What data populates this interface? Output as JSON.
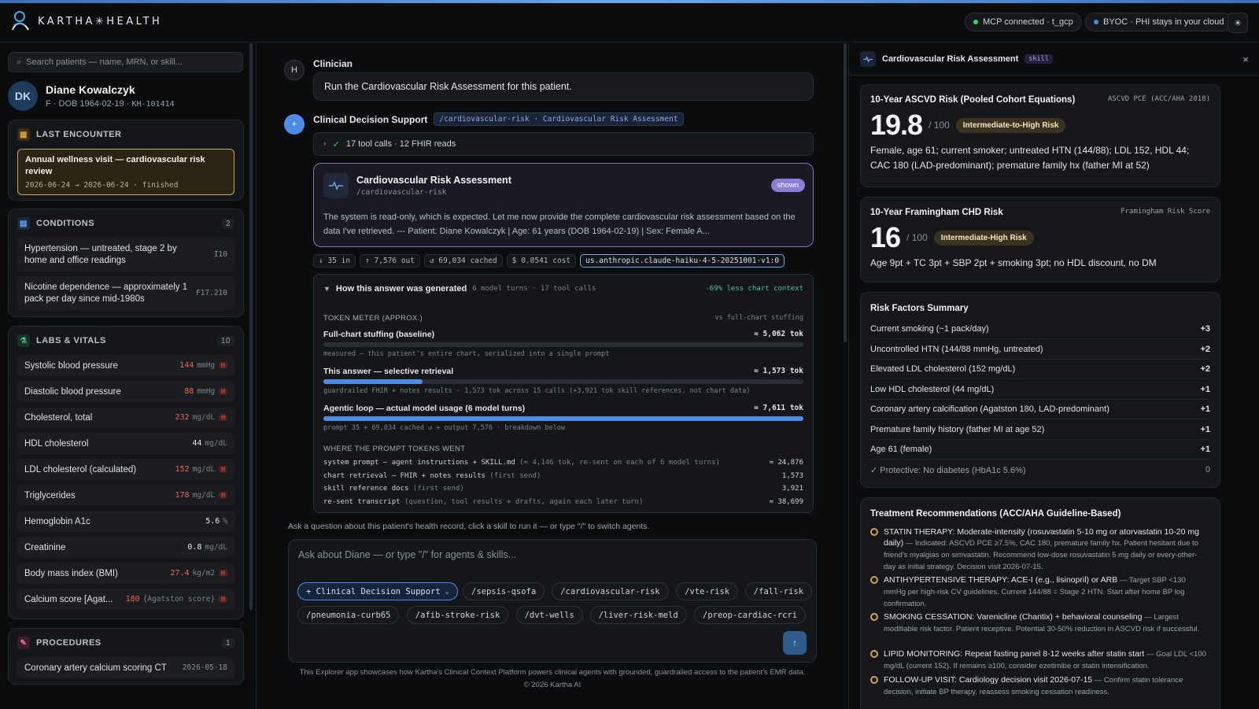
{
  "app": {
    "brand": "KARTHA✳HEALTH"
  },
  "header": {
    "mcp_status": "MCP connected · t_gcp",
    "byoc_status": "BYOC · PHI stays in your cloud",
    "mcp_color": "#3ecf6a",
    "byoc_color": "#4d8be8"
  },
  "sidebar": {
    "search_placeholder": "Search patients — name, MRN, or skill...",
    "patient": {
      "initials": "DK",
      "name": "Diane Kowalczyk",
      "meta": "F · DOB 1964-02-19 ·",
      "mrn": "KH-101414"
    },
    "last_encounter": {
      "heading": "LAST ENCOUNTER",
      "title": "Annual wellness visit — cardiovascular risk review",
      "dates": "2026-06-24 → 2026-06-24 · finished"
    },
    "conditions": {
      "heading": "CONDITIONS",
      "count": "2",
      "items": [
        {
          "label": "Hypertension — untreated, stage 2 by home and office readings",
          "code": "I10"
        },
        {
          "label": "Nicotine dependence — approximately 1 pack per day since mid-1980s",
          "code": "F17.210"
        }
      ]
    },
    "labs": {
      "heading": "LABS & VITALS",
      "count": "10",
      "items": [
        {
          "label": "Systolic blood pressure",
          "value": "144",
          "unit": "mmHg",
          "flag": "H"
        },
        {
          "label": "Diastolic blood pressure",
          "value": "88",
          "unit": "mmHg",
          "flag": "H"
        },
        {
          "label": "Cholesterol, total",
          "value": "232",
          "unit": "mg/dL",
          "flag": "H"
        },
        {
          "label": "HDL cholesterol",
          "value": "44",
          "unit": "mg/dL",
          "flag": ""
        },
        {
          "label": "LDL cholesterol (calculated)",
          "value": "152",
          "unit": "mg/dL",
          "flag": "H"
        },
        {
          "label": "Triglycerides",
          "value": "178",
          "unit": "mg/dL",
          "flag": "H"
        },
        {
          "label": "Hemoglobin A1c",
          "value": "5.6",
          "unit": "%",
          "flag": ""
        },
        {
          "label": "Creatinine",
          "value": "0.8",
          "unit": "mg/dL",
          "flag": ""
        },
        {
          "label": "Body mass index (BMI)",
          "value": "27.4",
          "unit": "kg/m2",
          "flag": "H"
        },
        {
          "label": "Calcium score [Agat...",
          "value": "180",
          "unit": "{Agatston score}",
          "flag": "H"
        }
      ]
    },
    "procedures": {
      "heading": "PROCEDURES",
      "count": "1",
      "items": [
        {
          "label": "Coronary artery calcium scoring CT",
          "date": "2026-05-18"
        }
      ]
    }
  },
  "chat": {
    "clinician": {
      "avatar": "H",
      "name": "Clinician",
      "message": "Run the Cardiovascular Risk Assessment for this patient."
    },
    "agent": {
      "avatar": "+",
      "name": "Clinical Decision Support",
      "route_tag": "/cardiovascular-risk · Cardiovascular Risk Assessment"
    },
    "tool_summary": "17 tool calls · 12 FHIR reads",
    "skill_card": {
      "title": "Cardiovascular Risk Assessment",
      "path": "/cardiovascular-risk",
      "badge": "shown",
      "preview": "The system is read-only, which is expected. Let me now provide the complete cardiovascular risk assessment based on the data I've retrieved. --- Patient: Diane Kowalczyk | Age: 61 years (DOB 1964-02-19) | Sex: Female  A..."
    },
    "stats": {
      "in": "↓ 35 in",
      "out": "↑ 7,576 out",
      "cached": "↺ 69,034 cached",
      "cost": "$ 0.0541 cost",
      "model": "us.anthropic.claude-haiku-4-5-20251001-v1:0"
    },
    "generation": {
      "heading": "How this answer was generated",
      "meta": "6 model turns · 17 tool calls",
      "savings": "-69% less chart context",
      "token_meter": "TOKEN METER (APPROX.)",
      "vs_label": "vs full-chart stuffing",
      "rows": [
        {
          "label": "Full-chart stuffing (baseline)",
          "value": "≈ 5,062 tok",
          "sub": "measured — this patient's entire chart, serialized into a single prompt",
          "fraction": 0
        },
        {
          "label": "This answer — selective retrieval",
          "value": "≈ 1,573 tok",
          "sub": "guardrailed FHIR + notes results · 1,573 tok across 15 calls (+3,921 tok skill references, not chart data)",
          "fraction": 0.207
        },
        {
          "label": "Agentic loop — actual model usage (6 model turns)",
          "value": "≈ 7,611 tok",
          "sub": "prompt 35 + 69,034 cached ↺ + output 7,576 · breakdown below",
          "fraction": 1
        }
      ],
      "prompt_heading": "WHERE THE PROMPT TOKENS WENT",
      "prompt_rows": [
        {
          "label": "system prompt — agent instructions + SKILL.md",
          "note": "(≈ 4,146 tok, re-sent on each of 6 model turns)",
          "value": "≈ 24,876"
        },
        {
          "label": "chart retrieval — FHIR + notes results",
          "note": "(first send)",
          "value": "1,573"
        },
        {
          "label": "skill reference docs",
          "note": "(first send)",
          "value": "3,921"
        },
        {
          "label": "re-sent transcript",
          "note": "(question, tool results + drafts, again each later turn)",
          "value": "≈ 38,699"
        }
      ]
    },
    "hint": "Ask a question about this patient's health record, click a skill to run it — or type \"/\" to switch agents.",
    "composer": {
      "placeholder": "Ask about Diane — or type \"/\" for agents & skills...",
      "agent_select": "+ Clinical Decision Support",
      "skills_row1": [
        "/sepsis-qsofa",
        "/cardiovascular-risk",
        "/vte-risk",
        "/fall-risk"
      ],
      "skills_row2": [
        "/pneumonia-curb65",
        "/afib-stroke-risk",
        "/dvt-wells",
        "/liver-risk-meld",
        "/preop-cardiac-rcri"
      ]
    },
    "footer": "This Explorer app showcases how Kartha's Clinical Context Platform powers clinical agents with grounded, guardrailed access to the patient's EMR data.",
    "copyright": "© 2026 Kartha AI"
  },
  "panel": {
    "title": "Cardiovascular Risk Assessment",
    "tag": "skill",
    "ascvd": {
      "title": "10-Year ASCVD Risk (Pooled Cohort Equations)",
      "method": "ASCVD PCE (ACC/AHA 2018)",
      "score": "19.8",
      "of": "/ 100",
      "badge": "Intermediate-to-High Risk",
      "desc": "Female, age 61; current smoker; untreated HTN (144/88); LDL 152, HDL 44; CAC 180 (LAD-predominant); premature family hx (father MI at 52)"
    },
    "framingham": {
      "title": "10-Year Framingham CHD Risk",
      "method": "Framingham Risk Score",
      "score": "16",
      "of": "/ 100",
      "badge": "Intermediate-High Risk",
      "desc": "Age 9pt + TC 3pt + SBP 2pt + smoking 3pt; no HDL discount, no DM"
    },
    "risk_factors": {
      "title": "Risk Factors Summary",
      "items": [
        {
          "label": "Current smoking (~1 pack/day)",
          "points": "+3"
        },
        {
          "label": "Uncontrolled HTN (144/88 mmHg, untreated)",
          "points": "+2"
        },
        {
          "label": "Elevated LDL cholesterol (152 mg/dL)",
          "points": "+2"
        },
        {
          "label": "Low HDL cholesterol (44 mg/dL)",
          "points": "+1"
        },
        {
          "label": "Coronary artery calcification (Agatston 180, LAD-predominant)",
          "points": "+1"
        },
        {
          "label": "Premature family history (father MI at age 52)",
          "points": "+1"
        },
        {
          "label": "Age 61 (female)",
          "points": "+1"
        },
        {
          "label": "✓ Protective: No diabetes (HbA1c 5.6%)",
          "points": "0"
        }
      ]
    },
    "treatments": {
      "title": "Treatment Recommendations (ACC/AHA Guideline-Based)",
      "items": [
        {
          "title": "STATIN THERAPY: Moderate-intensity (rosuvastatin 5-10 mg or atorvastatin 10-20 mg daily)",
          "detail": " — Indicated: ASCVD PCE ≥7.5%, CAC 180, premature family hx. Patient hesitant due to friend's myalgias on simvastatin. Recommend low-dose rosuvastatin 5 mg daily or every-other-day as initial strategy. Decision visit 2026-07-15."
        },
        {
          "title": "ANTIHYPERTENSIVE THERAPY: ACE-I (e.g., lisinopril) or ARB",
          "detail": " — Target SBP <130 mmHg per high-risk CV guidelines. Current 144/88 = Stage 2 HTN. Start after home BP log confirmation."
        },
        {
          "title": "SMOKING CESSATION: Varenicline (Chantix) + behavioral counseling",
          "detail": " — Largest modifiable risk factor. Patient receptive. Potential 30-50% reduction in ASCVD risk if successful."
        },
        {
          "title": "LIPID MONITORING: Repeat fasting panel 8-12 weeks after statin start",
          "detail": " — Goal LDL <100 mg/dL (current 152). If remains ≥100, consider ezetimibe or statin intensification."
        },
        {
          "title": "FOLLOW-UP VISIT: Cardiology decision visit 2026-07-15",
          "detail": " — Confirm statin tolerance decision, initiate BP therapy, reassess smoking cessation readiness."
        }
      ]
    }
  }
}
